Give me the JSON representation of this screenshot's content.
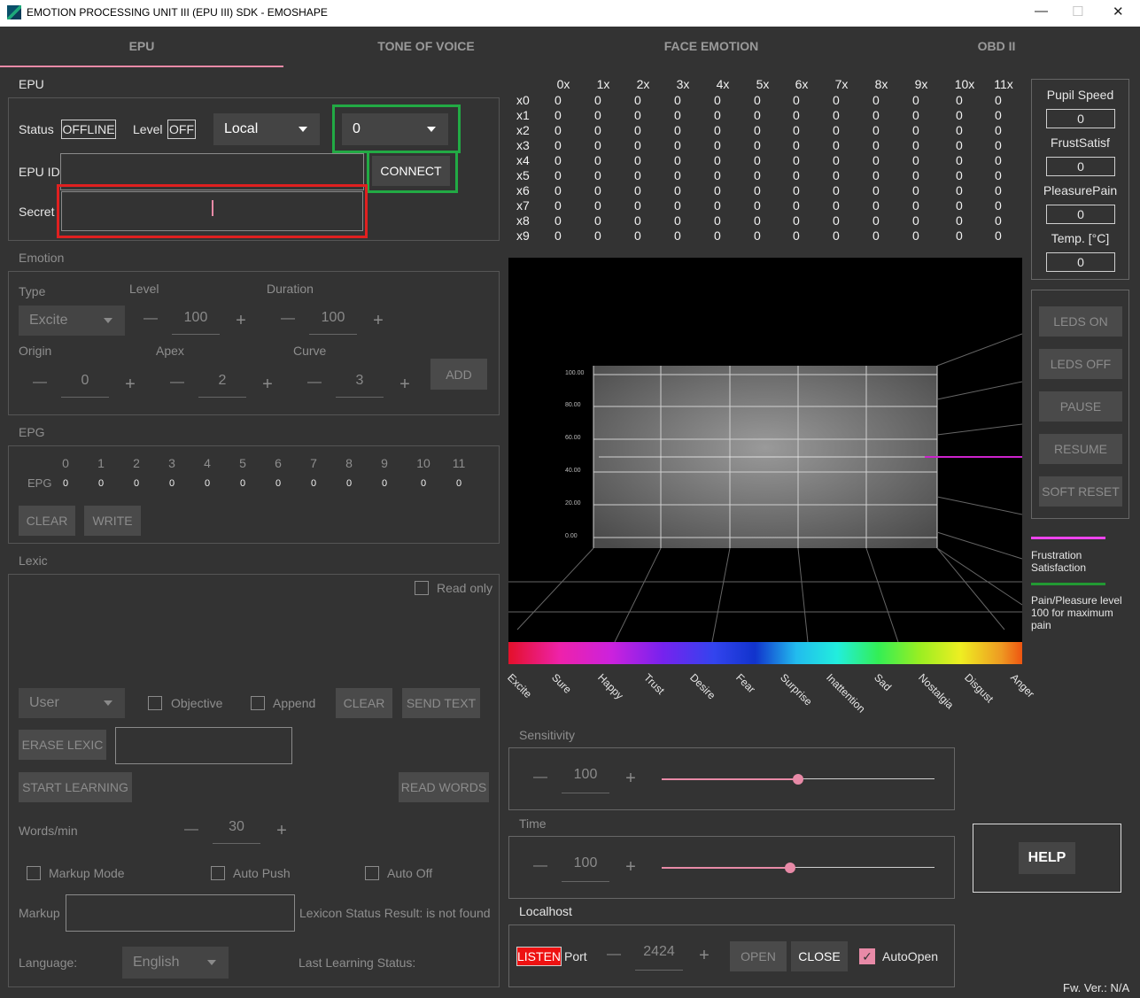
{
  "window": {
    "title": "EMOTION PROCESSING UNIT III (EPU III) SDK - EMOSHAPE",
    "minimize": "—",
    "maximize": "☐",
    "close": "✕"
  },
  "tabs": [
    {
      "label": "EPU"
    },
    {
      "label": "TONE OF VOICE"
    },
    {
      "label": "FACE EMOTION"
    },
    {
      "label": "OBD II"
    }
  ],
  "epu": {
    "section": "EPU",
    "status_label": "Status",
    "status_value": "OFFLINE",
    "level_label": "Level",
    "level_value": "OFF",
    "mode_select": "Local",
    "index_select": "0",
    "epu_id_label": "EPU ID",
    "epu_id_value": "",
    "connect": "CONNECT",
    "secret_label": "Secret",
    "secret_value": ""
  },
  "emotion": {
    "section": "Emotion",
    "type_label": "Type",
    "type_value": "Excite",
    "level_label": "Level",
    "level_value": "100",
    "duration_label": "Duration",
    "duration_value": "100",
    "origin_label": "Origin",
    "origin_value": "0",
    "apex_label": "Apex",
    "apex_value": "2",
    "curve_label": "Curve",
    "curve_value": "3",
    "add": "ADD",
    "minus": "—",
    "plus": "+"
  },
  "epg": {
    "section": "EPG",
    "row_label": "EPG",
    "headers": [
      "0",
      "1",
      "2",
      "3",
      "4",
      "5",
      "6",
      "7",
      "8",
      "9",
      "10",
      "11"
    ],
    "values": [
      "0",
      "0",
      "0",
      "0",
      "0",
      "0",
      "0",
      "0",
      "0",
      "0",
      "0",
      "0"
    ],
    "clear": "CLEAR",
    "write": "WRITE"
  },
  "lexic": {
    "section": "Lexic",
    "read_only": "Read only",
    "user_select": "User",
    "objective": "Objective",
    "append": "Append",
    "clear": "CLEAR",
    "send_text": "SEND TEXT",
    "erase_lexic": "ERASE LEXIC",
    "erase_input": "",
    "start_learning": "START LEARNING",
    "read_words": "READ WORDS",
    "words_per_min_label": "Words/min",
    "words_per_min_value": "30",
    "markup_mode": "Markup Mode",
    "auto_push": "Auto Push",
    "auto_off": "Auto Off",
    "markup_label": "Markup",
    "markup_value": "",
    "lexicon_status": "Lexicon Status Result: is not found",
    "language_label": "Language:",
    "language_value": "English",
    "last_learning": "Last Learning Status:"
  },
  "matrix": {
    "cols": [
      "0x",
      "1x",
      "2x",
      "3x",
      "4x",
      "5x",
      "6x",
      "7x",
      "8x",
      "9x",
      "10x",
      "11x"
    ],
    "rows": [
      "x0",
      "x1",
      "x2",
      "x3",
      "x4",
      "x5",
      "x6",
      "x7",
      "x8",
      "x9"
    ],
    "cell": "0"
  },
  "chart3d": {
    "ticks": [
      "100.00",
      "80.00",
      "60.00",
      "40.00",
      "20.00",
      "0.00"
    ],
    "emotions": [
      "Excite",
      "Sure",
      "Happy",
      "Trust",
      "Desire",
      "Fear",
      "Surprise",
      "Inattention",
      "Sad",
      "Nostalgia",
      "Disgust",
      "Anger"
    ]
  },
  "right_panel": {
    "pupil_speed_label": "Pupil Speed",
    "pupil_speed_value": "0",
    "frust_label": "FrustSatisf",
    "frust_value": "0",
    "pleasure_label": "PleasurePain",
    "pleasure_value": "0",
    "temp_label": "Temp. [°C]",
    "temp_value": "0",
    "leds_on": "LEDS ON",
    "leds_off": "LEDS OFF",
    "pause": "PAUSE",
    "resume": "RESUME",
    "soft_reset": "SOFT RESET",
    "legend1": "Frustration\nSatisfaction",
    "legend2": "Pain/Pleasure level\n100 for maximum\npain",
    "help": "HELP",
    "fw": "Fw. Ver.: N/A",
    "colors": {
      "frustration": "#ee44ee",
      "pain": "#229933"
    }
  },
  "sensitivity": {
    "label": "Sensitivity",
    "value": "100",
    "level": 0.5
  },
  "time": {
    "label": "Time",
    "value": "100",
    "level": 0.47
  },
  "localhost": {
    "label": "Localhost",
    "listen": "LISTEN",
    "port_label": "Port",
    "port_value": "2424",
    "open": "OPEN",
    "close": "CLOSE",
    "auto_open": "AutoOpen"
  }
}
